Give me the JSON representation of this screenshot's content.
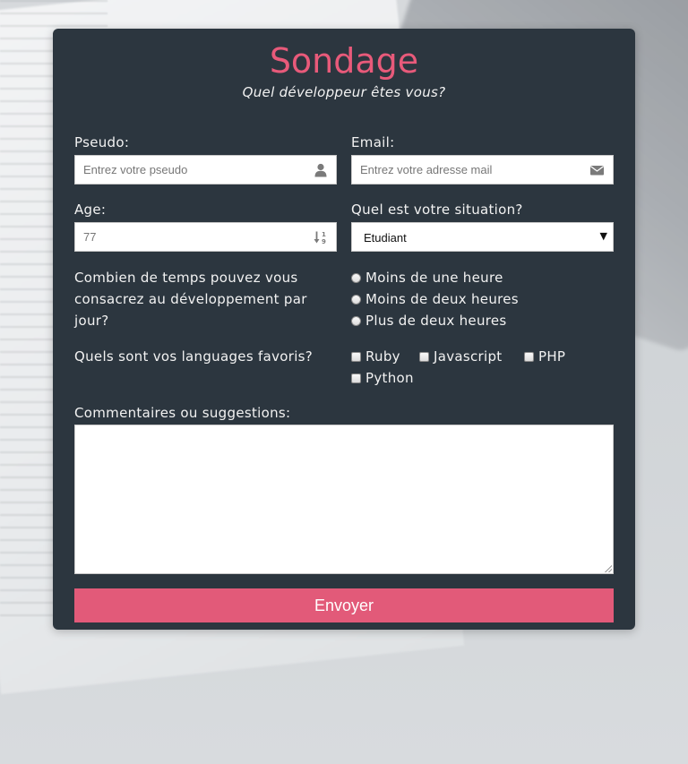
{
  "header": {
    "title": "Sondage",
    "subtitle": "Quel développeur êtes vous?"
  },
  "fields": {
    "pseudo": {
      "label": "Pseudo:",
      "placeholder": "Entrez votre pseudo",
      "icon": "user-icon"
    },
    "email": {
      "label": "Email:",
      "placeholder": "Entrez votre adresse mail",
      "icon": "envelope-icon"
    },
    "age": {
      "label": "Age:",
      "placeholder": "77",
      "icon": "sort-numeric-icon"
    },
    "situation": {
      "label": "Quel est votre situation?",
      "selected": "Etudiant",
      "arrow": "▼"
    }
  },
  "time_question": {
    "label": "Combien de temps pouvez vous consacrez au développement par jour?",
    "options": [
      "Moins de une heure",
      "Moins de deux heures",
      "Plus de deux heures"
    ]
  },
  "languages_question": {
    "label": "Quels sont vos languages favoris?",
    "options": [
      "Ruby",
      "Javascript",
      "PHP",
      "Python"
    ]
  },
  "comments": {
    "label": "Commentaires ou suggestions:"
  },
  "submit": {
    "label": "Envoyer"
  },
  "colors": {
    "card_bg": "#2c363f",
    "accent": "#e25a79",
    "title": "#e85a7a",
    "text": "#f2f2f2"
  }
}
